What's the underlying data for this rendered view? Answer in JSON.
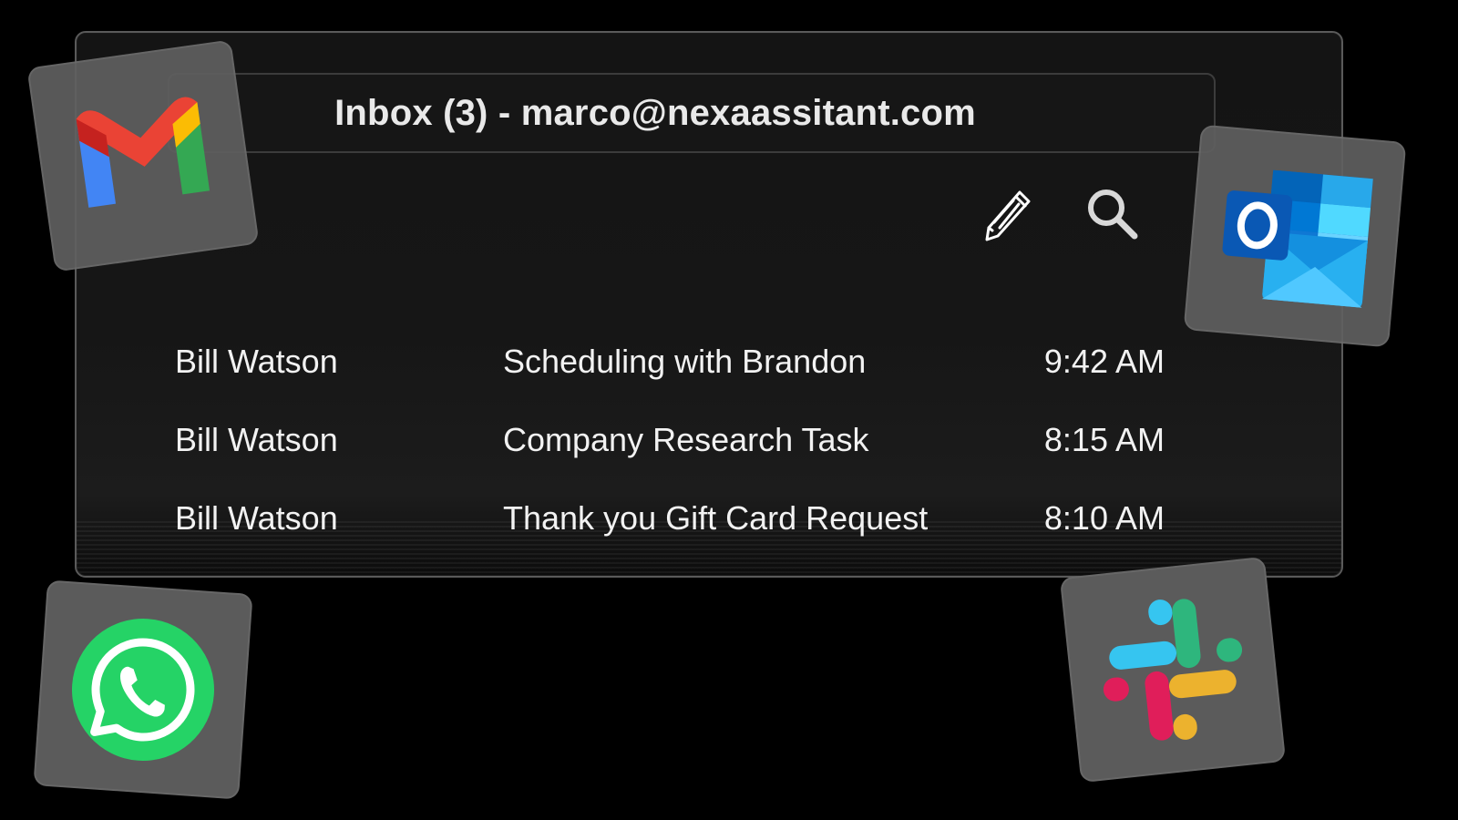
{
  "window": {
    "title": "Inbox (3) - marco@nexaassitant.com"
  },
  "toolbar": {
    "compose_icon": "pencil-icon",
    "search_icon": "search-icon"
  },
  "emails": [
    {
      "sender": "Bill Watson",
      "subject": "Scheduling with Brandon",
      "time": "9:42 AM"
    },
    {
      "sender": "Bill Watson",
      "subject": "Company Research Task",
      "time": "8:15 AM"
    },
    {
      "sender": "Bill Watson",
      "subject": "Thank you Gift Card Request",
      "time": "8:10 AM"
    }
  ],
  "apps": [
    {
      "icon": "gmail-icon"
    },
    {
      "icon": "outlook-icon"
    },
    {
      "icon": "whatsapp-icon"
    },
    {
      "icon": "slack-icon"
    }
  ],
  "colors": {
    "background": "#000000",
    "window_bg": "#161616",
    "text": "#f2f2f2",
    "tile_bg": "#5b5b5b",
    "gmail_red": "#ea4335",
    "gmail_blue": "#4285f4",
    "gmail_green": "#34a853",
    "gmail_yellow": "#fbbc04",
    "outlook_blue": "#0a64c8",
    "whatsapp_green": "#25d366",
    "slack_blue": "#36c5f0",
    "slack_green": "#2eb67d",
    "slack_red": "#e01e5a",
    "slack_yellow": "#ecb22e"
  }
}
